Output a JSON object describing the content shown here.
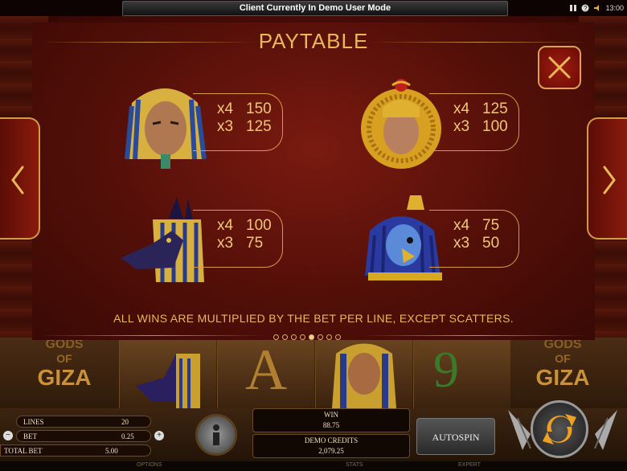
{
  "banner": {
    "text": "Client Currently In Demo User Mode"
  },
  "status_bar": {
    "time": "13:00"
  },
  "paytable": {
    "title": "PAYTABLE",
    "note": "ALL WINS ARE MULTIPLIED BY THE BET PER LINE, EXCEPT SCATTERS.",
    "pages": 8,
    "active_page": 5,
    "symbols": [
      {
        "icon": "pharaoh-symbol-icon",
        "rows": [
          {
            "mult": "x4",
            "pay": "150"
          },
          {
            "mult": "x3",
            "pay": "125"
          }
        ]
      },
      {
        "icon": "queen-symbol-icon",
        "rows": [
          {
            "mult": "x4",
            "pay": "125"
          },
          {
            "mult": "x3",
            "pay": "100"
          }
        ]
      },
      {
        "icon": "anubis-symbol-icon",
        "rows": [
          {
            "mult": "x4",
            "pay": "100"
          },
          {
            "mult": "x3",
            "pay": "75"
          }
        ]
      },
      {
        "icon": "horus-symbol-icon",
        "rows": [
          {
            "mult": "x4",
            "pay": "75"
          },
          {
            "mult": "x3",
            "pay": "50"
          }
        ]
      }
    ]
  },
  "reels": {
    "logo_line1": "GODS",
    "logo_line2": "OF",
    "logo_line3": "GIZA",
    "letter_a": "A",
    "number_9": "9"
  },
  "controls": {
    "lines_label": "LINES",
    "lines_value": "20",
    "bet_label": "BET",
    "bet_value": "0.25",
    "total_bet_label": "TOTAL BET",
    "total_bet_value": "5.00",
    "win_label": "WIN",
    "win_value": "88.75",
    "credits_label": "DEMO CREDITS",
    "credits_value": "2,079.25",
    "autospin_label": "AUTOSPIN"
  },
  "tabs": {
    "options": "OPTIONS",
    "stats": "STATS",
    "expert": "EXPERT"
  },
  "colors": {
    "gold": "#e8b85a",
    "panel": "#520f08",
    "border": "#d89a4a"
  }
}
